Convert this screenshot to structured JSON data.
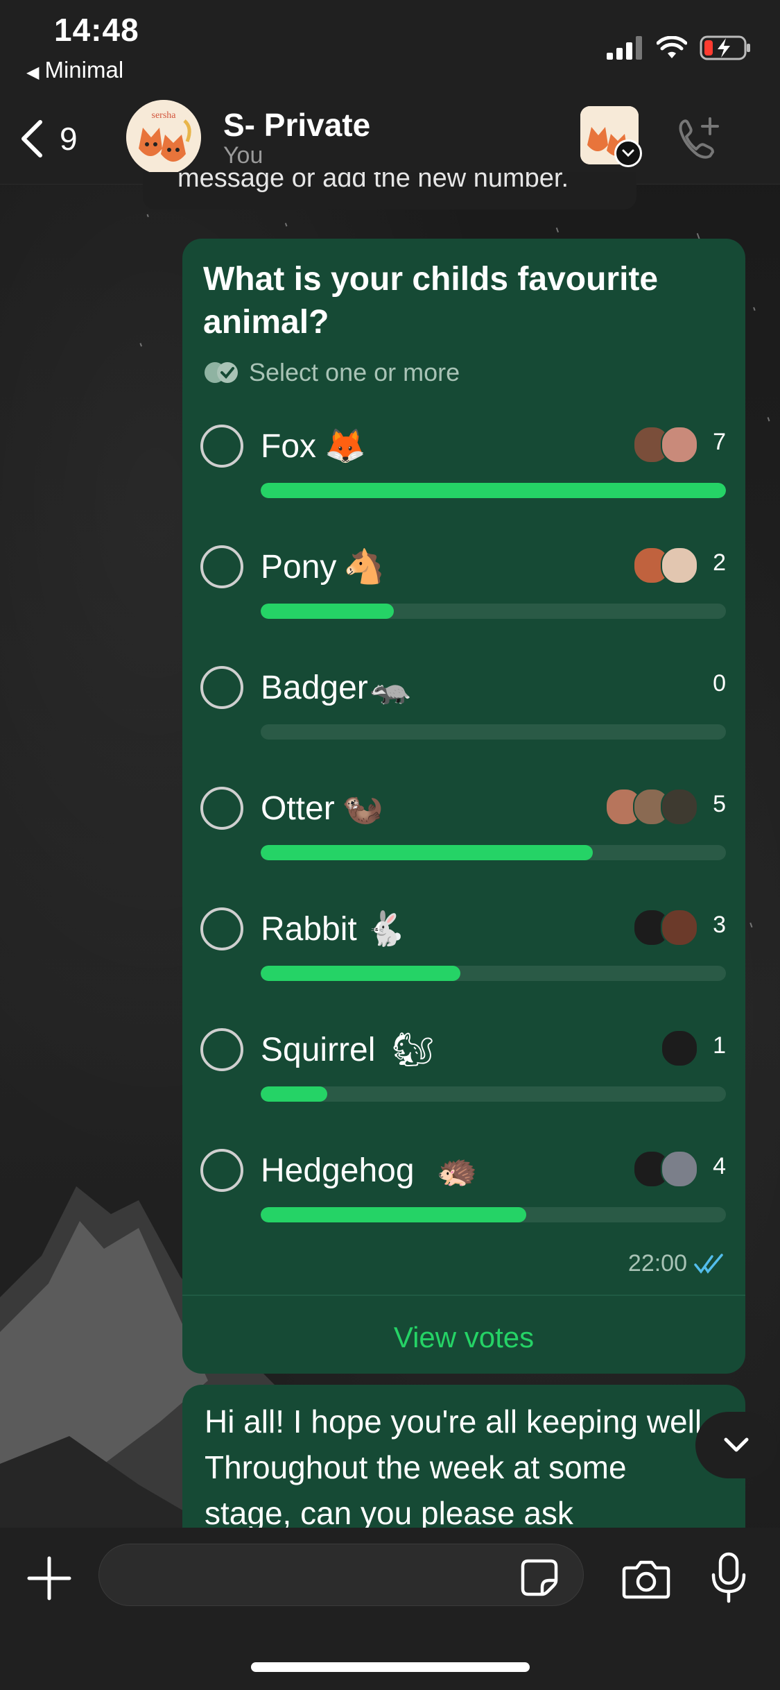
{
  "status_bar": {
    "time": "14:48",
    "back_app": "Minimal",
    "icons": [
      "cellular-signal-icon",
      "wifi-icon",
      "battery-low-charging-icon"
    ]
  },
  "header": {
    "unread_count": "9",
    "title": "S- Private",
    "subtitle": "You",
    "avatar_text": "sersha"
  },
  "previous_message": {
    "text": "message or add the new number."
  },
  "poll": {
    "question": "What is your childs favourite animal?",
    "hint": "Select one or more",
    "options": [
      {
        "label": "Fox",
        "emoji": "🦊",
        "votes": "7",
        "fraction": 1.0
      },
      {
        "label": "Pony",
        "emoji": "🐴",
        "votes": "2",
        "fraction": 0.286
      },
      {
        "label": "Badger",
        "emoji": "🦡",
        "votes": "0",
        "fraction": 0.0
      },
      {
        "label": "Otter",
        "emoji": "🦦",
        "votes": "5",
        "fraction": 0.714
      },
      {
        "label": "Rabbit",
        "emoji": "🐇",
        "votes": "3",
        "fraction": 0.429
      },
      {
        "label": "Squirrel",
        "emoji": "🐿",
        "votes": "1",
        "fraction": 0.143
      },
      {
        "label": "Hedgehog",
        "emoji": "🦔",
        "votes": "4",
        "fraction": 0.571
      }
    ],
    "time": "22:00",
    "view_votes": "View votes"
  },
  "next_message": {
    "text": "Hi all! I hope you're all keeping well. Throughout the week at some stage, can you please ask"
  },
  "colors": {
    "bubble": "#164a35",
    "accent": "#25d366",
    "read_ticks": "#53bdeb"
  }
}
